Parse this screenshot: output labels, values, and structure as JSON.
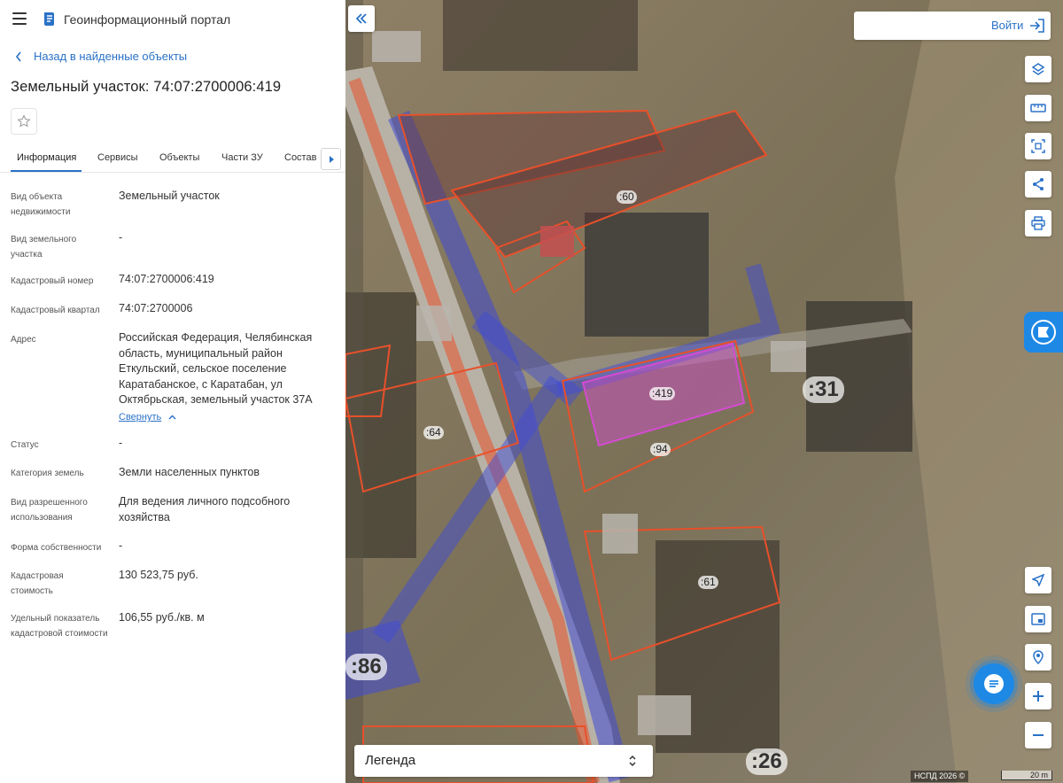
{
  "app": {
    "title": "Геоинформационный портал"
  },
  "nav": {
    "back_label": "Назад в найденные объекты"
  },
  "object": {
    "title": "Земельный участок: 74:07:2700006:419"
  },
  "tabs": [
    {
      "label": "Информация"
    },
    {
      "label": "Сервисы"
    },
    {
      "label": "Объекты"
    },
    {
      "label": "Части ЗУ"
    },
    {
      "label": "Состав"
    }
  ],
  "info": {
    "rows": [
      {
        "label": "Вид объекта недвижимости",
        "value": "Земельный участок"
      },
      {
        "label": "Вид земельного участка",
        "value": "-"
      },
      {
        "label": "Кадастровый номер",
        "value": "74:07:2700006:419"
      },
      {
        "label": "Кадастровый квартал",
        "value": "74:07:2700006"
      },
      {
        "label": "Адрес",
        "value": "Российская Федерация, Челябинская область, муниципальный район Еткульский, сельское поселение Каратабанское, с Каратабан, ул Октябрьская, земельный участок 37А"
      },
      {
        "label": "Статус",
        "value": "-"
      },
      {
        "label": "Категория земель",
        "value": "Земли населенных пунктов"
      },
      {
        "label": "Вид разрешенного использования",
        "value": "Для ведения личного подсобного хозяйства"
      },
      {
        "label": "Форма собственности",
        "value": "-"
      },
      {
        "label": "Кадастровая стоимость",
        "value": "130 523,75 руб."
      },
      {
        "label": "Удельный показатель кадастровой стоимости",
        "value": "106,55 руб./кв. м"
      }
    ],
    "collapse_label": "Свернуть"
  },
  "map": {
    "login_label": "Войти",
    "legend_label": "Легенда",
    "attribution": "НСПД 2026 ©",
    "scale_label": "20 m",
    "parcel_labels": [
      ":60",
      ":419",
      ":31",
      ":64",
      ":94",
      ":61",
      ":86",
      ":26"
    ]
  },
  "colors": {
    "accent": "#2a72c7",
    "parcel_border": "#e8502a",
    "selected_parcel": "#d44bd0",
    "zone": "#3f4bd6"
  }
}
